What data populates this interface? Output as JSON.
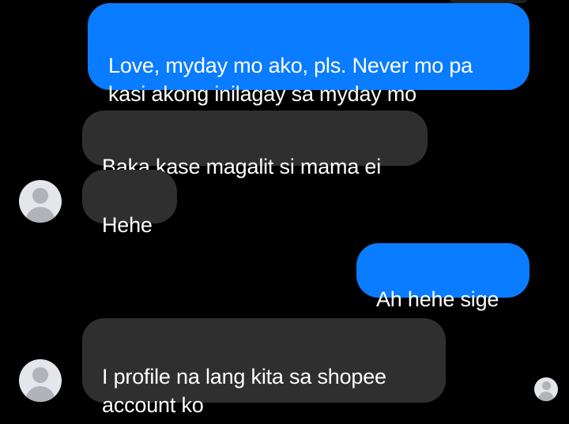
{
  "conversation": {
    "messages": [
      {
        "id": "m1",
        "sender": "me",
        "text": "Love, myday mo ako, pls. Never mo pa\nkasi akong inilagay sa myday mo"
      },
      {
        "id": "m2",
        "sender": "them",
        "text": "Baka kase magalit si mama ei"
      },
      {
        "id": "m3",
        "sender": "them",
        "text": "Hehe"
      },
      {
        "id": "m4",
        "sender": "me",
        "text": "Ah hehe sige"
      },
      {
        "id": "m5",
        "sender": "them",
        "text": "I profile na lang kita sa shopee\naccount ko"
      }
    ]
  },
  "icons": {
    "avatar": "default-user-avatar-icon",
    "seen": "seen-receipt-avatar-icon"
  },
  "colors": {
    "background": "#000000",
    "outgoing_bubble": "#0a7cff",
    "incoming_bubble": "#2f2f2f",
    "text": "#ffffff",
    "avatar_bg": "#e4e6eb",
    "avatar_fg": "#b0b3b8"
  }
}
